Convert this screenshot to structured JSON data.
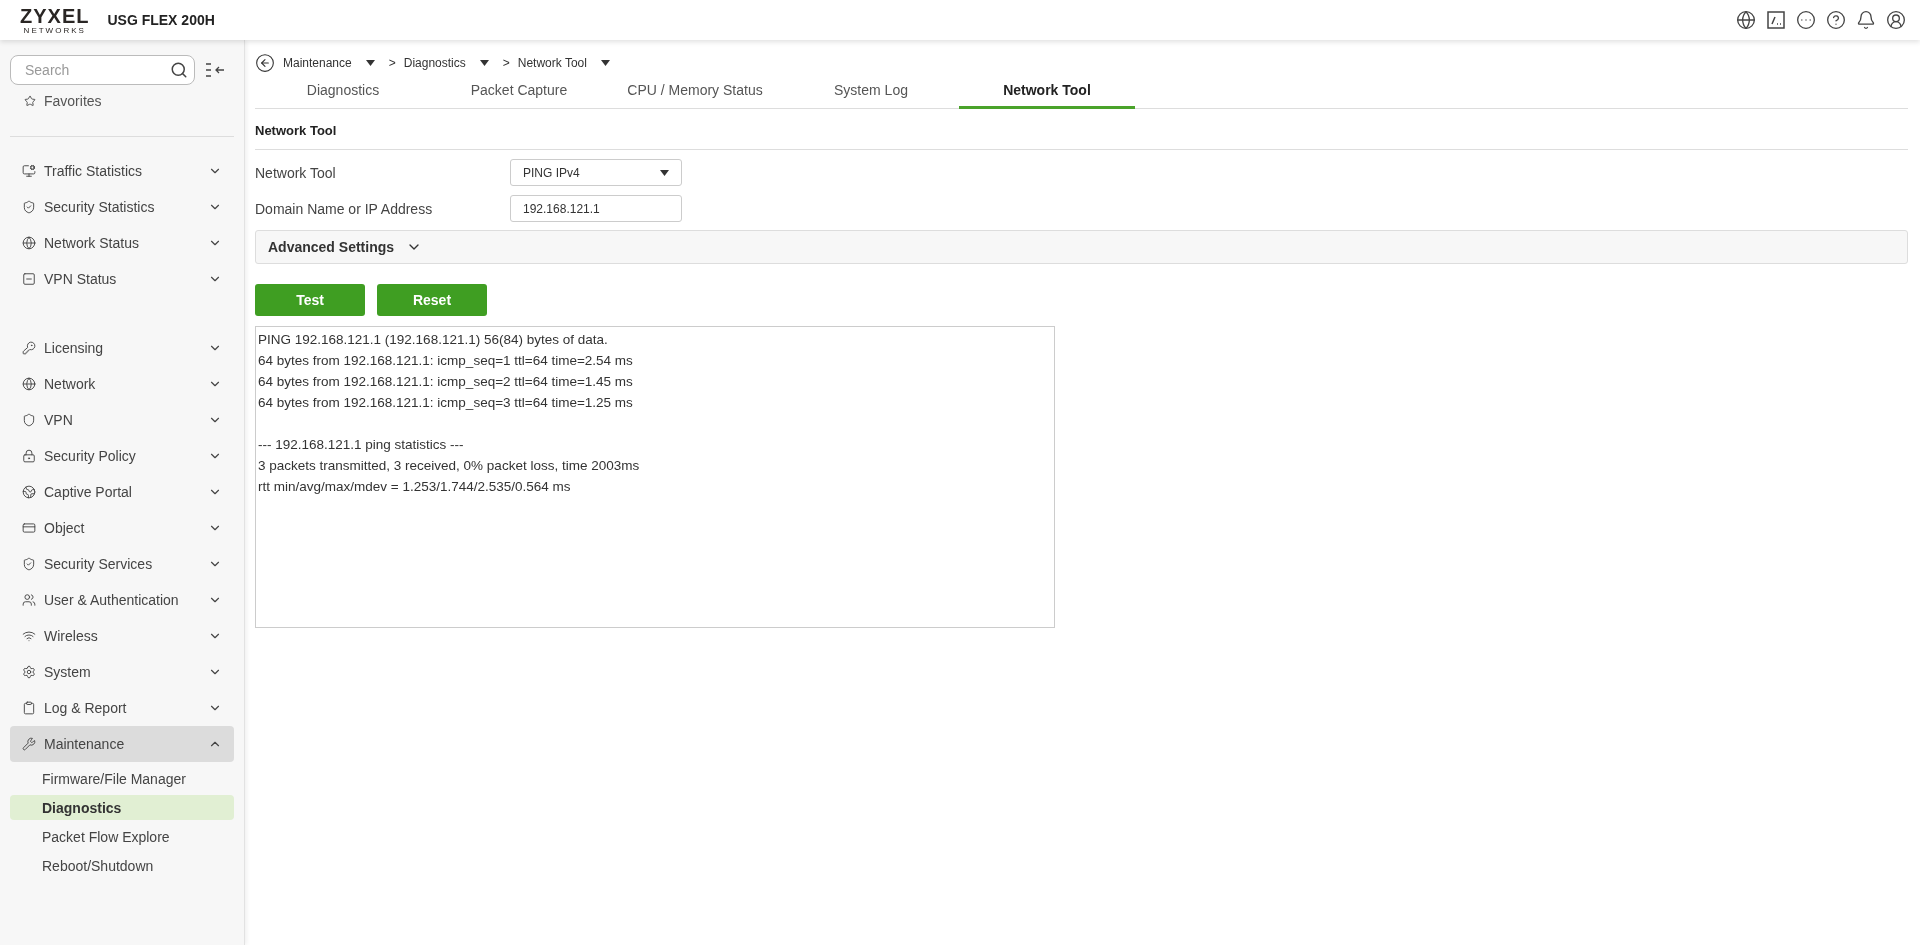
{
  "header": {
    "logo": {
      "name": "ZYXEL",
      "tagline": "NETWORKS"
    },
    "model": "USG FLEX 200H"
  },
  "sidebar": {
    "search": {
      "placeholder": "Search"
    },
    "favorites": "Favorites",
    "groups": [
      {
        "items": [
          {
            "label": "Traffic Statistics",
            "expanded": false,
            "selected": false
          },
          {
            "label": "Security Statistics",
            "expanded": false,
            "selected": false
          },
          {
            "label": "Network Status",
            "expanded": false,
            "selected": false
          },
          {
            "label": "VPN Status",
            "expanded": false,
            "selected": false
          }
        ]
      },
      {
        "items": [
          {
            "label": "Licensing",
            "expanded": false,
            "selected": false
          },
          {
            "label": "Network",
            "expanded": false,
            "selected": false
          },
          {
            "label": "VPN",
            "expanded": false,
            "selected": false
          },
          {
            "label": "Security Policy",
            "expanded": false,
            "selected": false
          },
          {
            "label": "Captive Portal",
            "expanded": false,
            "selected": false
          },
          {
            "label": "Object",
            "expanded": false,
            "selected": false
          },
          {
            "label": "Security Services",
            "expanded": false,
            "selected": false
          },
          {
            "label": "User & Authentication",
            "expanded": false,
            "selected": false
          },
          {
            "label": "Wireless",
            "expanded": false,
            "selected": false
          },
          {
            "label": "System",
            "expanded": false,
            "selected": false
          },
          {
            "label": "Log & Report",
            "expanded": false,
            "selected": false
          },
          {
            "label": "Maintenance",
            "expanded": true,
            "selected": true,
            "children": [
              {
                "label": "Firmware/File Manager",
                "selected": false
              },
              {
                "label": "Diagnostics",
                "selected": true
              },
              {
                "label": "Packet Flow Explore",
                "selected": false
              },
              {
                "label": "Reboot/Shutdown",
                "selected": false
              }
            ]
          }
        ]
      }
    ]
  },
  "breadcrumb": [
    {
      "label": "Maintenance"
    },
    {
      "separator": ">",
      "label": "Diagnostics"
    },
    {
      "separator": ">",
      "label": "Network Tool"
    }
  ],
  "tabs": [
    {
      "label": "Diagnostics",
      "selected": false
    },
    {
      "label": "Packet Capture",
      "selected": false
    },
    {
      "label": "CPU / Memory Status",
      "selected": false
    },
    {
      "label": "System Log",
      "selected": false
    },
    {
      "label": "Network Tool",
      "selected": true
    }
  ],
  "section_title": "Network Tool",
  "form": [
    {
      "label": "Network Tool",
      "kind": "select",
      "value": "PING IPv4"
    },
    {
      "label": "Domain Name or IP Address",
      "kind": "input",
      "value": "192.168.121.1"
    }
  ],
  "advanced_settings": {
    "label": "Advanced Settings",
    "expanded": false
  },
  "buttons": [
    "Test",
    "Reset"
  ],
  "output": [
    [
      "PING 192.168.121.1 (192.168.121.1) 56(84) bytes of data.",
      "64 bytes from 192.168.121.1: icmp_seq=1 ttl=64 time=2.54 ms",
      "64 bytes from 192.168.121.1: icmp_seq=2 ttl=64 time=1.45 ms",
      "64 bytes from 192.168.121.1: icmp_seq=3 ttl=64 time=1.25 ms"
    ],
    [
      "--- 192.168.121.1 ping statistics ---",
      "3 packets transmitted, 3 received, 0% packet loss, time 2003ms",
      "rtt min/avg/max/mdev = 1.253/1.744/2.535/0.564 ms"
    ]
  ]
}
